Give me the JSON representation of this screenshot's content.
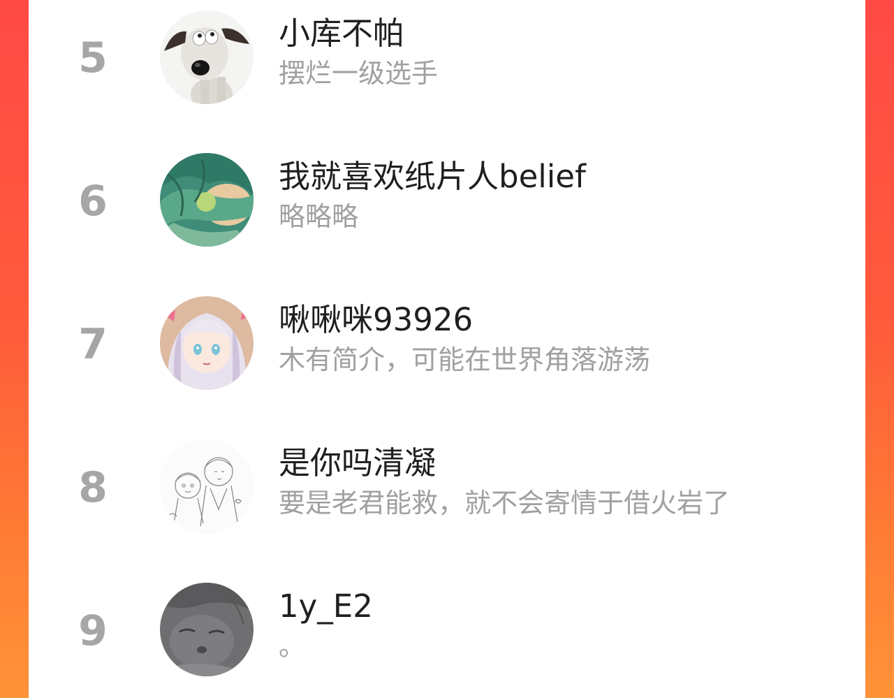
{
  "ranking": {
    "entries": [
      {
        "rank": "5",
        "name": "小库不帕",
        "bio": "摆烂一级选手",
        "avatar": "cartoon-dog-avatar"
      },
      {
        "rank": "6",
        "name": "我就喜欢纸片人belief",
        "bio": "略略略",
        "avatar": "anime-green-hair-avatar"
      },
      {
        "rank": "7",
        "name": "啾啾咪93926",
        "bio": "木有简介，可能在世界角落游荡",
        "avatar": "anime-girl-avatar"
      },
      {
        "rank": "8",
        "name": "是你吗清凝",
        "bio": "要是老君能救，就不会寄情于借火岩了",
        "avatar": "sketch-drawing-avatar"
      },
      {
        "rank": "9",
        "name": "1y_E2",
        "bio": "。",
        "avatar": "grey-cat-avatar"
      }
    ]
  },
  "colors": {
    "background_gradient_top": "#ff4a45",
    "background_gradient_bottom": "#ff9338",
    "rank_text": "#a6a6a6",
    "name_text": "#1f1f1f",
    "bio_text": "#a0a0a0"
  }
}
